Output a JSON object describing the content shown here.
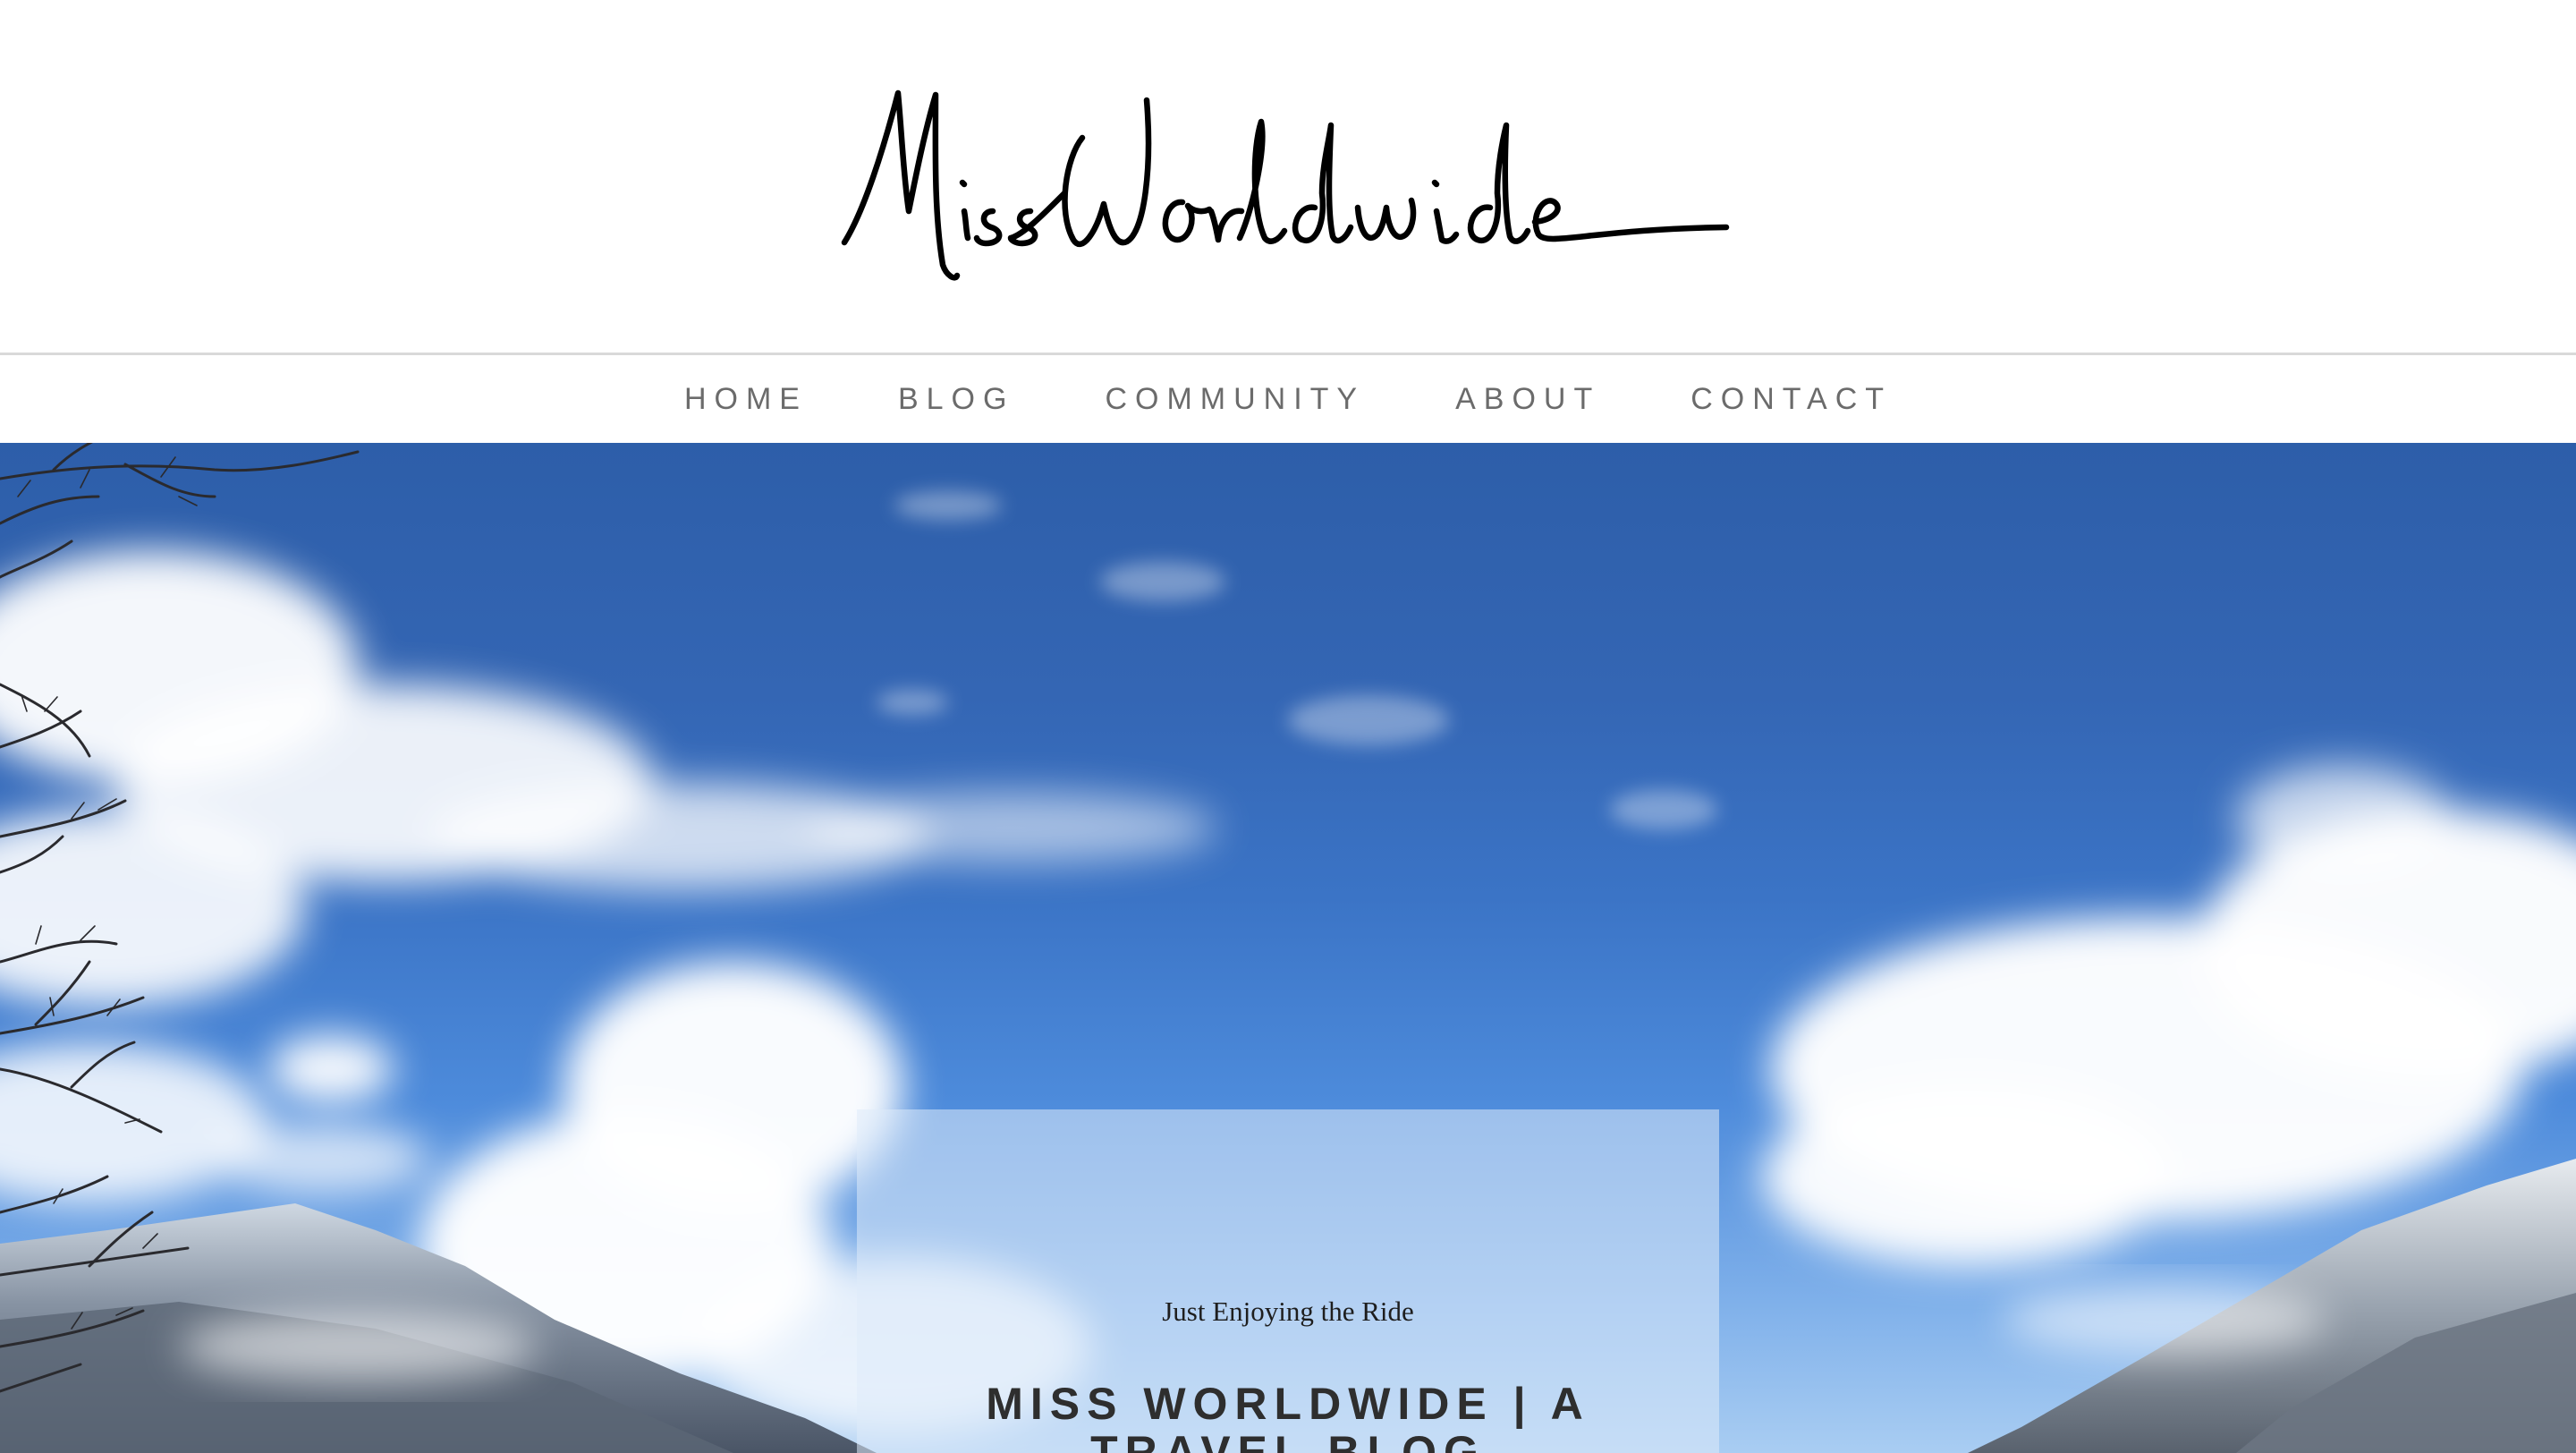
{
  "site": {
    "logo_text": "Miss Worldwide"
  },
  "nav": {
    "items": [
      {
        "label": "HOME"
      },
      {
        "label": "BLOG"
      },
      {
        "label": "COMMUNITY"
      },
      {
        "label": "ABOUT"
      },
      {
        "label": "CONTACT"
      }
    ]
  },
  "hero": {
    "tagline": "Just Enjoying the Ride",
    "title": "MISS WORLDWIDE | A TRAVEL BLOG"
  },
  "colors": {
    "nav_text": "#6b6b6b",
    "sky_top": "#2d5ea9",
    "sky_bottom": "#a9cdf2",
    "card_overlay": "rgba(223,235,250,0.55)",
    "title_text": "#2e2e2e"
  },
  "icons": {
    "logo": "handwritten-signature-logo"
  }
}
